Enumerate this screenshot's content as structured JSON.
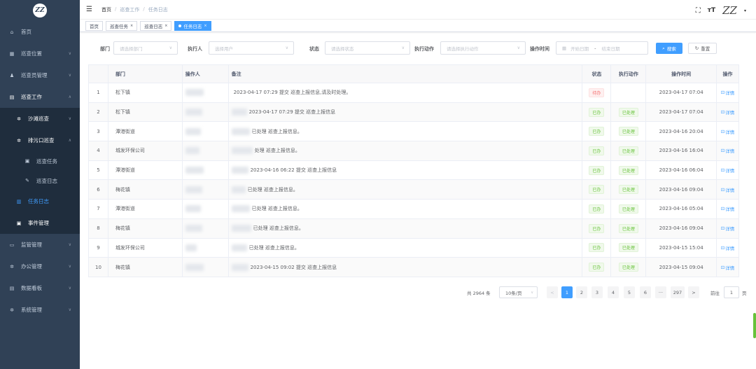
{
  "sidebar": {
    "logo_text": "ZZ",
    "items": [
      {
        "icon": "home-icon",
        "icon_glyph": "⌂",
        "label": "首页"
      },
      {
        "icon": "grid-icon",
        "icon_glyph": "▦",
        "label": "巡查位置"
      },
      {
        "icon": "user-icon",
        "icon_glyph": "♟",
        "label": "巡查员管理"
      },
      {
        "icon": "document-icon",
        "icon_glyph": "▤",
        "label": "巡查工作"
      },
      {
        "icon": "gear-icon",
        "icon_glyph": "✲",
        "label": "沙滩巡查"
      },
      {
        "icon": "gear-icon",
        "icon_glyph": "✲",
        "label": "排污口巡查"
      },
      {
        "icon": "list-icon",
        "icon_glyph": "▣",
        "label": "巡查任务"
      },
      {
        "icon": "edit-icon",
        "icon_glyph": "✎",
        "label": "巡查日志"
      },
      {
        "icon": "calendar-icon",
        "icon_glyph": "▥",
        "label": "任务日志"
      },
      {
        "icon": "list-icon",
        "icon_glyph": "▣",
        "label": "事件管理"
      },
      {
        "icon": "monitor-icon",
        "icon_glyph": "▭",
        "label": "监管管理"
      },
      {
        "icon": "gear-icon",
        "icon_glyph": "✲",
        "label": "办公管理"
      },
      {
        "icon": "chart-icon",
        "icon_glyph": "▤",
        "label": "数据看板"
      },
      {
        "icon": "gear-icon",
        "icon_glyph": "✲",
        "label": "系统管理"
      }
    ]
  },
  "navbar": {
    "breadcrumb": [
      "首页",
      "巡查工作",
      "任务日志"
    ],
    "logo_text": "ZZ"
  },
  "tags": [
    {
      "label": "首页"
    },
    {
      "label": "巡查任务"
    },
    {
      "label": "巡查日志"
    },
    {
      "label": "任务日志"
    }
  ],
  "search": {
    "dept_label": "部门",
    "dept_placeholder": "请选择部门",
    "executor_label": "执行人",
    "executor_placeholder": "选择用户",
    "status_label": "状态",
    "status_placeholder": "请选择状态",
    "action_label": "执行动作",
    "action_placeholder": "请选择执行动作",
    "time_label": "操作时间",
    "start_placeholder": "开始日期",
    "date_sep": "-",
    "end_placeholder": "结束日期",
    "search_button": "搜索",
    "reset_button": "重置"
  },
  "table": {
    "headers": [
      "",
      "部门",
      "操作人",
      "备注",
      "状态",
      "执行动作",
      "操作时间",
      "操作"
    ],
    "rows": [
      {
        "idx": "1",
        "dept": "松下镇",
        "note": "2023-04-17 07:29 提交 巡查上报信息,请及时处理。",
        "status": "待办",
        "status_color": "#f56c6c",
        "action": "",
        "time": "2023-04-17 07:04",
        "op": "详情"
      },
      {
        "idx": "2",
        "dept": "松下镇",
        "note": "2023-04-17 07:29 提交 巡查上报信息",
        "status": "已办",
        "status_color": "#67c23a",
        "action": "已处理",
        "time": "2023-04-17 07:04",
        "op": "详情"
      },
      {
        "idx": "3",
        "dept": "潭港街道",
        "note": "已处理 巡查上报信息。",
        "status": "已办",
        "status_color": "#67c23a",
        "action": "已处理",
        "time": "2023-04-16 20:04",
        "op": "详情"
      },
      {
        "idx": "4",
        "dept": "城发环保公司",
        "note": "处理 巡查上报信息。",
        "status": "已办",
        "status_color": "#67c23a",
        "action": "已处理",
        "time": "2023-04-16 16:04",
        "op": "详情"
      },
      {
        "idx": "5",
        "dept": "潭港街道",
        "note": "2023-04-16 06:22 提交 巡查上报信息",
        "status": "已办",
        "status_color": "#67c23a",
        "action": "已处理",
        "time": "2023-04-16 06:04",
        "op": "详情"
      },
      {
        "idx": "6",
        "dept": "梅花镇",
        "note": "已处理 巡查上报信息。",
        "status": "已办",
        "status_color": "#67c23a",
        "action": "已处理",
        "time": "2023-04-16 09:04",
        "op": "详情"
      },
      {
        "idx": "7",
        "dept": "潭港街道",
        "note": "已处理 巡查上报信息。",
        "status": "已办",
        "status_color": "#67c23a",
        "action": "已处理",
        "time": "2023-04-16 05:04",
        "op": "详情"
      },
      {
        "idx": "8",
        "dept": "梅花镇",
        "note": "已处理 巡查上报信息。",
        "status": "已办",
        "status_color": "#67c23a",
        "action": "已处理",
        "time": "2023-04-16 09:04",
        "op": "详情"
      },
      {
        "idx": "9",
        "dept": "城发环保公司",
        "note": "已处理 巡查上报信息。",
        "status": "已办",
        "status_color": "#67c23a",
        "action": "已处理",
        "time": "2023-04-15 15:04",
        "op": "详情"
      },
      {
        "idx": "10",
        "dept": "梅花镇",
        "note": "2023-04-15 09:02 提交 巡查上报信息",
        "status": "已办",
        "status_color": "#67c23a",
        "action": "已处理",
        "time": "2023-04-15 09:04",
        "op": "详情"
      }
    ]
  },
  "pagination": {
    "total": "共 2964 条",
    "page_size": "10条/页",
    "prev": "<",
    "pages": [
      "1",
      "2",
      "3",
      "4",
      "5",
      "6",
      "···",
      "297"
    ],
    "next": ">",
    "goto_label": "前往",
    "goto_value": "1",
    "goto_unit": "页"
  },
  "colors": {
    "primary": "#409eff",
    "sidebar_bg": "#304156",
    "success": "#67c23a",
    "danger": "#f56c6c"
  }
}
